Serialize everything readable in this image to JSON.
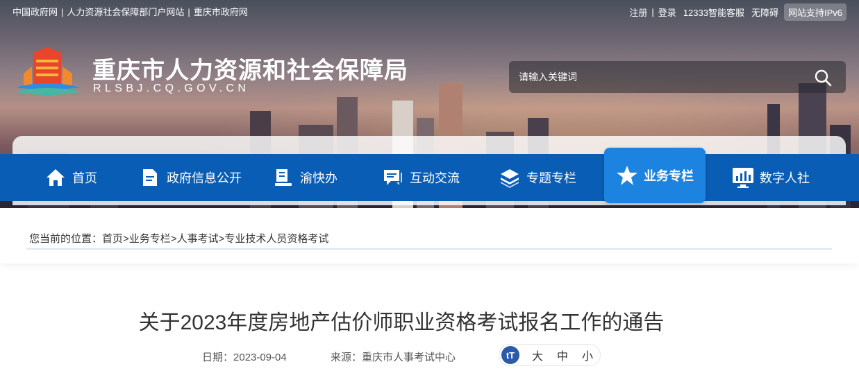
{
  "topbar": {
    "links": [
      "中国政府网",
      "人力资源社会保障部门户网站",
      "重庆市政府网"
    ],
    "separator": "|",
    "register": "注册",
    "login": "登录",
    "hotline": "12333智能客服",
    "accessibility": "无障碍",
    "ipv6": "网站支持IPv6"
  },
  "header": {
    "title": "重庆市人力资源和社会保障局",
    "domain": "RLSBJ.CQ.GOV.CN",
    "search_placeholder": "请输入关键词"
  },
  "nav": {
    "items": [
      {
        "label": "首页",
        "icon": "home-icon"
      },
      {
        "label": "政府信息公开",
        "icon": "document-icon"
      },
      {
        "label": "渝快办",
        "icon": "book-stand-icon"
      },
      {
        "label": "互动交流",
        "icon": "chat-icon"
      },
      {
        "label": "专题专栏",
        "icon": "layers-icon"
      },
      {
        "label": "业务专栏",
        "icon": "star-icon",
        "active": true
      },
      {
        "label": "数字人社",
        "icon": "monitor-chart-icon"
      }
    ]
  },
  "breadcrumb": {
    "prefix": "您当前的位置：",
    "items": [
      "首页",
      "业务专栏",
      "人事考试",
      "专业技术人员资格考试"
    ],
    "separator": ">"
  },
  "article": {
    "title": "关于2023年度房地产估价师职业资格考试报名工作的通告",
    "date_label": "日期：",
    "date": "2023-09-04",
    "source_label": "来源：",
    "source": "重庆市人事考试中心",
    "font_icon": "tT",
    "font_large": "大",
    "font_medium": "中",
    "font_small": "小"
  },
  "colors": {
    "nav_bg": "#0a5db5",
    "nav_active": "#1c84e0"
  }
}
